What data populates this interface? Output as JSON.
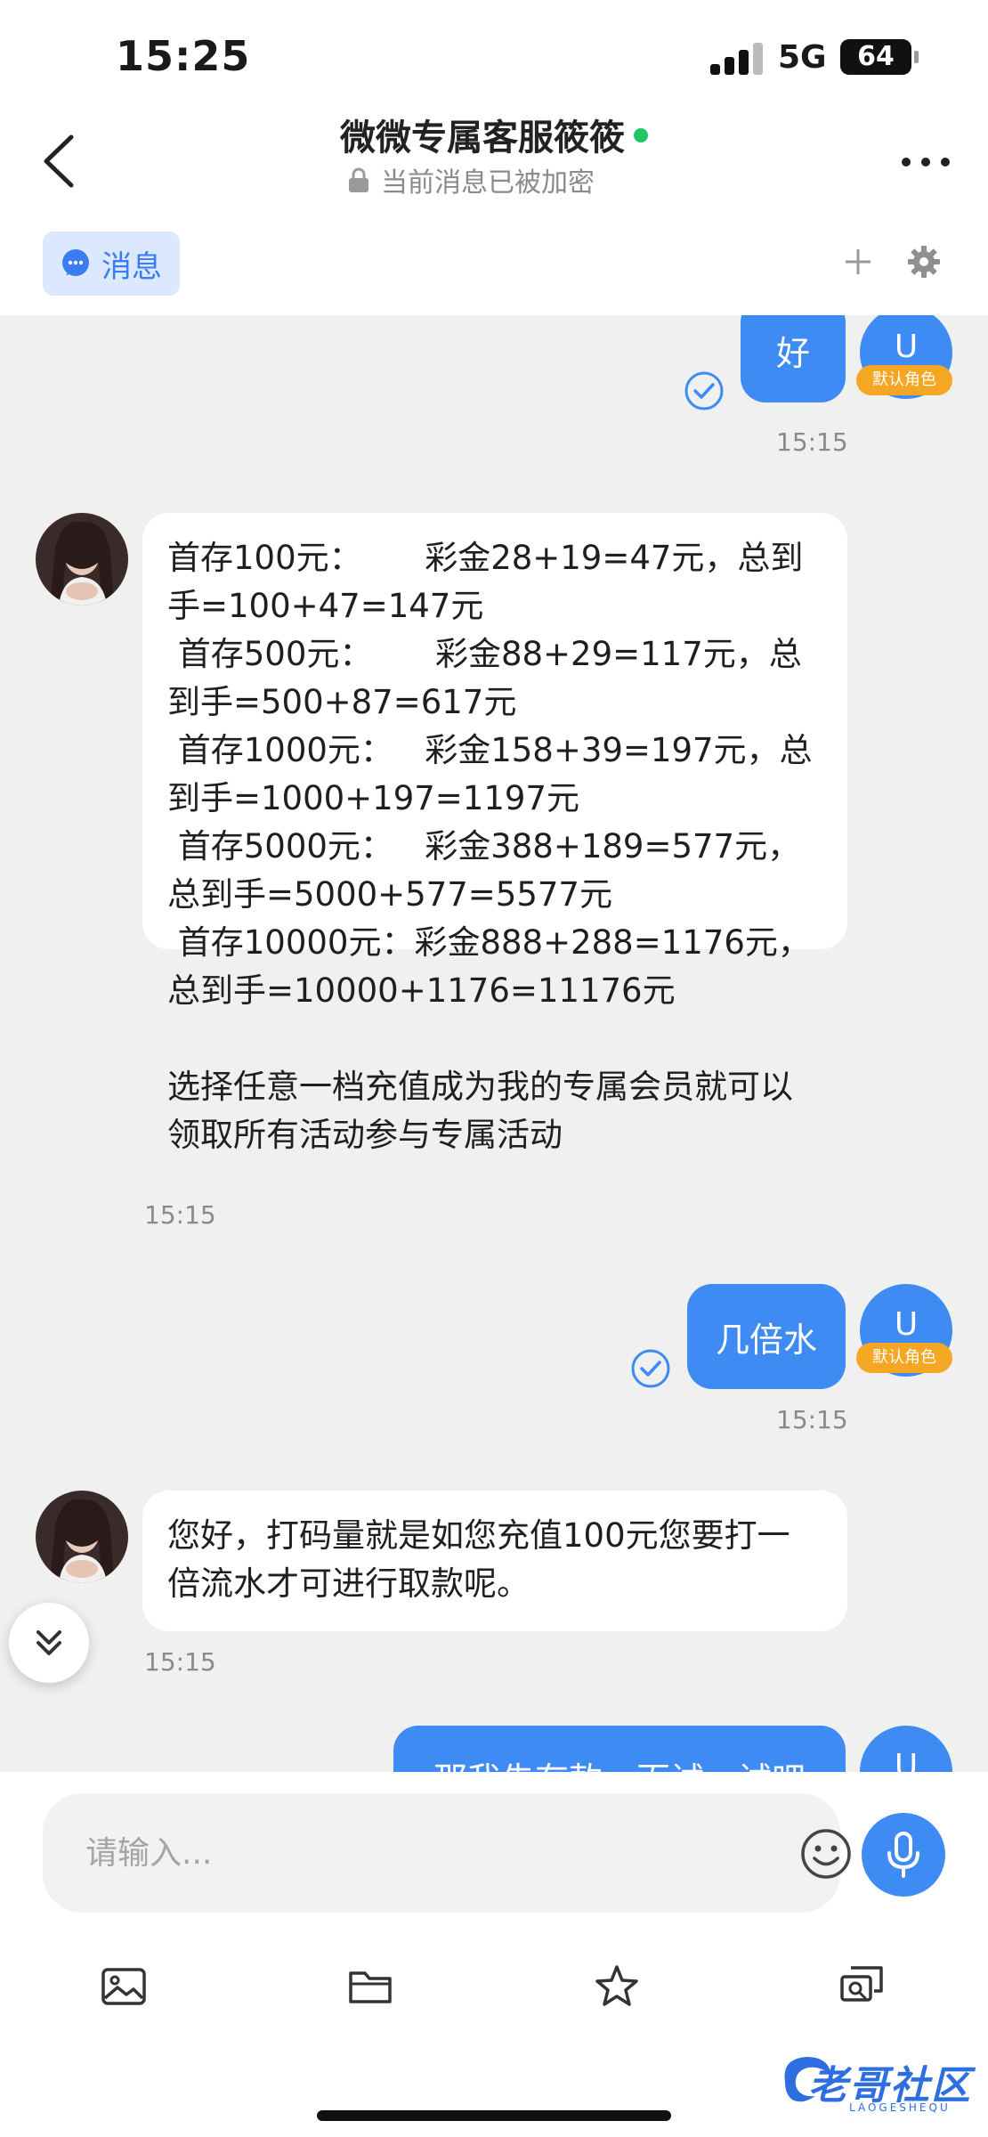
{
  "status_bar": {
    "time": "15:25",
    "network": "5G",
    "battery": "64"
  },
  "header": {
    "title": "微微专属客服筱筱",
    "encryption_note": "当前消息已被加密"
  },
  "tabs": {
    "messages_label": "消息"
  },
  "messages": [
    {
      "direction": "out",
      "text": "好",
      "time": "15:15",
      "avatar_letter": "U",
      "role_badge": "默认角色",
      "read": true
    },
    {
      "direction": "in",
      "text": "首存100元：      彩金28+19=47元，总到手=100+47=147元\n 首存500元：      彩金88+29=117元，总到手=500+87=617元\n 首存1000元：   彩金158+39=197元，总到手=1000+197=1197元\n 首存5000元：   彩金388+189=577元，总到手=5000+577=5577元\n 首存10000元：彩金888+288=1176元，总到手=10000+1176=11176元\n\n选择任意一档充值成为我的专属会员就可以领取所有活动参与专属活动",
      "time": "15:15"
    },
    {
      "direction": "out",
      "text": "几倍水",
      "time": "15:15",
      "avatar_letter": "U",
      "role_badge": "默认角色",
      "read": true
    },
    {
      "direction": "in",
      "text": "您好，打码量就是如您充值100元您要打一倍流水才可进行取款呢。",
      "time": "15:15"
    },
    {
      "direction": "out",
      "text": "那我先存款一百试一试吧",
      "avatar_letter": "U"
    }
  ],
  "input": {
    "placeholder": "请输入..."
  },
  "toolbar": [
    "image-icon",
    "folder-icon",
    "star-icon",
    "search-chat-icon"
  ],
  "watermark": {
    "main": "老哥社区",
    "sub": "LAOGESHEQU"
  },
  "colors": {
    "accent": "#3e8bf3",
    "badge": "#f5a623",
    "online": "#22c55e",
    "tab_bg": "#dbe8fd",
    "chat_bg": "#f0f0f0"
  }
}
